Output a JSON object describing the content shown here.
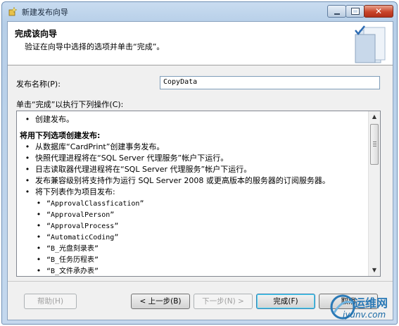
{
  "window": {
    "title": "新建发布向导",
    "close_glyph": "✕",
    "colors": {
      "frame": "#c4d8ee",
      "close": "#c9452a",
      "accent": "#3c7fb1"
    }
  },
  "header": {
    "title": "完成该向导",
    "subtitle": "验证在向导中选择的选项并单击“完成”。"
  },
  "form": {
    "pubname_label": "发布名称(P):",
    "pubname_value": "CopyData",
    "actions_label": "单击“完成”以执行下列操作(C):"
  },
  "actions": {
    "bullet": "•",
    "item1": "创建发布。",
    "heading": "将用下列选项创建发布:",
    "items": [
      "从数据库“CardPrint”创建事务发布。",
      "快照代理进程将在“SQL Server 代理服务”帐户下运行。",
      "日志读取器代理进程将在“SQL Server 代理服务”帐户下运行。",
      "发布兼容级别将支持作为运行 SQL Server 2008 或更高版本的服务器的订阅服务器。",
      "将下列表作为项目发布:"
    ],
    "tables": [
      "“ApprovalClassfication”",
      "“ApprovalPerson”",
      "“ApprovalProcess”",
      "“AutomaticCoding”",
      "“B_光盘刻录表”",
      "“B_任务历程表”",
      "“B_文件承办表”"
    ]
  },
  "buttons": {
    "help": "帮助(H)",
    "back": "< 上一步(B)",
    "next": "下一步(N) >",
    "finish": "完成(F)",
    "cancel": "取消"
  },
  "watermark": {
    "cn": "运维网",
    "url": "iyunv.com"
  }
}
